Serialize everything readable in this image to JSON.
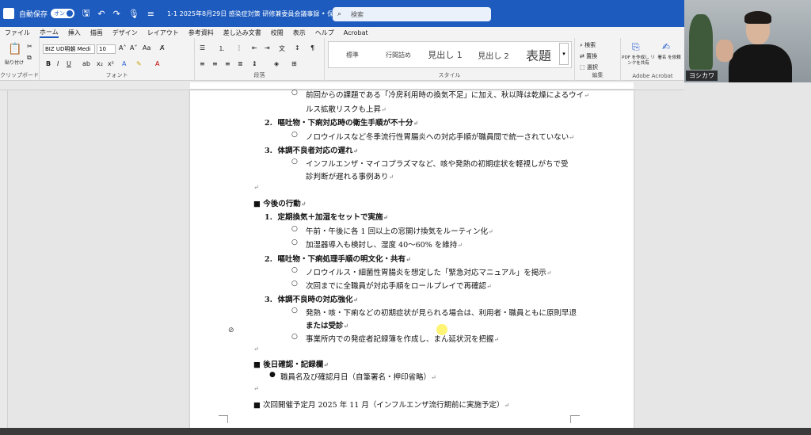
{
  "titlebar": {
    "autosave": "自動保存",
    "toggle": "オン",
    "doc_title": "1-1  2025年8月29日  感染症対策  研修兼委員会議事録 • 保存済み ∨",
    "search_placeholder": "検索"
  },
  "menu": {
    "items": [
      "ファイル",
      "ホーム",
      "挿入",
      "描画",
      "デザイン",
      "レイアウト",
      "参考資料",
      "差し込み文書",
      "校閲",
      "表示",
      "ヘルプ",
      "Acrobat"
    ]
  },
  "ribbon": {
    "clipboard_label": "クリップボード",
    "paste_label": "貼り付け",
    "font_name": "BIZ UD明朝 Medi",
    "font_size": "10",
    "font_label": "フォント",
    "paragraph_label": "段落",
    "style_label": "スタイル",
    "styles": [
      "標準",
      "行間詰め",
      "見出し 1",
      "見出し 2",
      "表題"
    ],
    "edit_label": "編集",
    "edit_items": [
      "検索",
      "置換",
      "選択"
    ],
    "acrobat_label": "Adobe Acrobat",
    "acrobat_items": [
      "PDF を作成し リンクを共有",
      "署名 を依頼"
    ]
  },
  "webcam": {
    "name": "ヨシカワ"
  },
  "document": {
    "top_partial": "前回からの課題である「冷房利用時の換気不足」に加え、秋以降は乾燥によるウイ",
    "top_cont": "ルス拡散リスクも上昇",
    "num2_title": "嘔吐物・下痢対応時の衛生手順が不十分",
    "num2_sub": "ノロウイルスなど冬季流行性胃腸炎への対応手順が職員間で統一されていない",
    "num3_title": "体調不良者対応の遅れ",
    "num3_sub1": "インフルエンザ・マイコプラズマなど、咳や発熱の初期症状を軽視しがちで受",
    "num3_sub2": "診判断が遅れる事例あり",
    "sec_action": "■ 今後の行動",
    "act1_title": "定期換気＋加湿をセットで実施",
    "act1_a": "午前・午後に各 1 回以上の窓開け換気をルーティン化",
    "act1_b": "加湿器導入も検討し、湿度 40～60% を維持",
    "act2_title": "嘔吐物・下痢処理手順の明文化・共有",
    "act2_a": "ノロウイルス・細菌性胃腸炎を想定した「緊急対応マニュアル」を掲示",
    "act2_b": "次回までに全職員が対応手順をロールプレイで再確認",
    "act3_title": "体調不良時の対応強化",
    "act3_a1": "発熱・咳・下痢などの初期症状が見られる場合は、利用者・職員ともに原則早退",
    "act3_a2": "または受診",
    "act3_b": "事業所内での発症者記録簿を作成し、まん延状況を把握",
    "sec_confirm": "■ 後日確認・記録欄",
    "confirm_item": "職員名及び確認月日（自筆署名・押印省略）",
    "sec_next": "■ 次回開催予定月 2025 年 11 月（インフルエンザ流行期前に実施予定）",
    "num_labels": [
      "2.",
      "3.",
      "1.",
      "2.",
      "3."
    ],
    "pilcrow": "↵"
  }
}
